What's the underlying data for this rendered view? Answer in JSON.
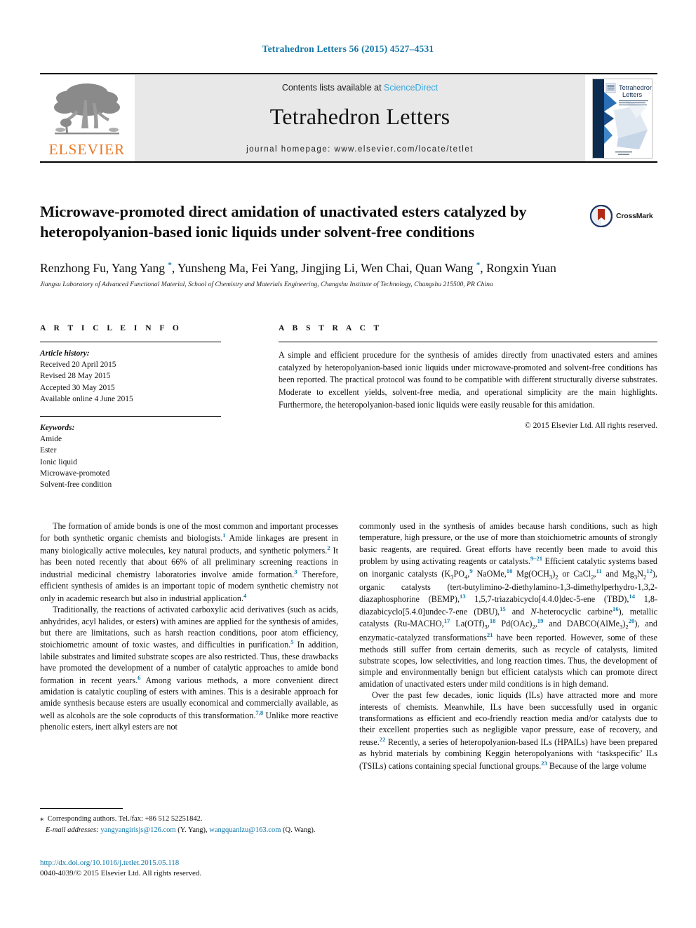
{
  "running_head": "Tetrahedron Letters 56 (2015) 4527–4531",
  "masthead": {
    "contents_prefix": "Contents lists available at ",
    "sciencedirect": "ScienceDirect",
    "journal_name": "Tetrahedron Letters",
    "homepage": "journal homepage: www.elsevier.com/locate/tetlet",
    "publisher_logo_text": "ELSEVIER",
    "cover_title_line1": "Tetrahedron",
    "cover_title_line2": "Letters",
    "colors": {
      "accent_blue": "#1277a8",
      "sciencedirect_blue": "#3aa6dd",
      "elsevier_orange": "#e87722",
      "masthead_grey": "#e8e8e8"
    }
  },
  "title": "Microwave-promoted direct amidation of unactivated esters catalyzed by heteropolyanion-based ionic liquids under solvent-free conditions",
  "crossmark": {
    "label": "CrossMark"
  },
  "authors_html": "Renzhong Fu, Yang Yang <sup>*</sup>, Yunsheng Ma, Fei Yang, Jingjing Li, Wen Chai, Quan Wang <sup>*</sup>, Rongxin Yuan",
  "affiliation": "Jiangsu Laboratory of Advanced Functional Material, School of Chemistry and Materials Engineering, Changshu Institute of Technology, Changshu 215500, PR China",
  "article_info": {
    "heading": "A R T I C L E   I N F O",
    "history_label": "Article history:",
    "history": [
      "Received 20 April 2015",
      "Revised 28 May 2015",
      "Accepted 30 May 2015",
      "Available online 4 June 2015"
    ],
    "keywords_label": "Keywords:",
    "keywords": [
      "Amide",
      "Ester",
      "Ionic liquid",
      "Microwave-promoted",
      "Solvent-free condition"
    ]
  },
  "abstract": {
    "heading": "A B S T R A C T",
    "text": "A simple and efficient procedure for the synthesis of amides directly from unactivated esters and amines catalyzed by heteropolyanion-based ionic liquids under microwave-promoted and solvent-free conditions has been reported. The practical protocol was found to be compatible with different structurally diverse substrates. Moderate to excellent yields, solvent-free media, and operational simplicity are the main highlights. Furthermore, the heteropolyanion-based ionic liquids were easily reusable for this amidation.",
    "copyright": "© 2015 Elsevier Ltd. All rights reserved."
  },
  "body": {
    "left_paragraphs_html": [
      "The formation of amide bonds is one of the most common and important processes for both synthetic organic chemists and biologists.<sup>1</sup> Amide linkages are present in many biologically active molecules, key natural products, and synthetic polymers.<sup>2</sup> It has been noted recently that about 66% of all preliminary screening reactions in industrial medicinal chemistry laboratories involve amide formation.<sup>3</sup> Therefore, efficient synthesis of amides is an important topic of modern synthetic chemistry not only in academic research but also in industrial application.<sup>4</sup>",
      "Traditionally, the reactions of activated carboxylic acid derivatives (such as acids, anhydrides, acyl halides, or esters) with amines are applied for the synthesis of amides, but there are limitations, such as harsh reaction conditions, poor atom efficiency, stoichiometric amount of toxic wastes, and difficulties in purification.<sup>5</sup> In addition, labile substrates and limited substrate scopes are also restricted. Thus, these drawbacks have promoted the development of a number of catalytic approaches to amide bond formation in recent years.<sup>6</sup> Among various methods, a more convenient direct amidation is catalytic coupling of esters with amines. This is a desirable approach for amide synthesis because esters are usually economical and commercially available, as well as alcohols are the sole coproducts of this transformation.<sup>7,8</sup> Unlike more reactive phenolic esters, inert alkyl esters are not"
    ],
    "right_paragraphs_html": [
      "commonly used in the synthesis of amides because harsh conditions, such as high temperature, high pressure, or the use of more than stoichiometric amounts of strongly basic reagents, are required. Great efforts have recently been made to avoid this problem by using activating reagents or catalysts.<sup>9–21</sup> Efficient catalytic systems based on inorganic catalysts (K<sub>3</sub>PO<sub>4</sub>,<sup>9</sup> NaOMe,<sup>10</sup> Mg(OCH<sub>3</sub>)<sub>2</sub> or CaCl<sub>2</sub>,<sup>11</sup> and Mg<sub>3</sub>N<sub>2</sub><sup>12</sup>), organic catalysts (tert-butylimino-2-diethylamino-1,3-dimethylperhydro-1,3,2-diazaphosphorine (BEMP),<sup>13</sup> 1,5,7-triazabicyclo[4.4.0]dec-5-ene (TBD),<sup>14</sup> 1,8-diazabicyclo[5.4.0]undec-7-ene (DBU),<sup>15</sup> and <span class=\"ital\">N</span>-heterocyclic carbine<sup>16</sup>), metallic catalysts (Ru-MACHO,<sup>17</sup> La(OTf)<sub>3</sub>,<sup>18</sup> Pd(OAc)<sub>2</sub>,<sup>19</sup> and DABCO(AlMe<sub>3</sub>)<sub>2</sub><sup>20</sup>), and enzymatic-catalyzed transformations<sup>21</sup> have been reported. However, some of these methods still suffer from certain demerits, such as recycle of catalysts, limited substrate scopes, low selectivities, and long reaction times. Thus, the development of simple and environmentally benign but efficient catalysts which can promote direct amidation of unactivated esters under mild conditions is in high demand.",
      "Over the past few decades, ionic liquids (ILs) have attracted more and more interests of chemists. Meanwhile, ILs have been successfully used in organic transformations as efficient and eco-friendly reaction media and/or catalysts due to their excellent properties such as negligible vapor pressure, ease of recovery, and reuse.<sup>22</sup> Recently, a series of heteropolyanion-based ILs (HPAILs) have been prepared as hybrid materials by combining Keggin heteropolyanions with ‘taskspecific’ ILs (TSILs) cations containing special functional groups.<sup>23</sup> Because of the large volume"
    ]
  },
  "footnotes": {
    "corresponding_html": "<span class=\"star\">⁎</span>&nbsp; Corresponding authors. Tel./fax: +86 512 52251842.",
    "email_label": "E-mail addresses:",
    "email_1": "yangyangirisjs@126.com",
    "email_1_owner": "(Y. Yang)",
    "email_2": "wangquanlzu@163.com",
    "email_2_owner": "(Q. Wang).",
    "doi": "http://dx.doi.org/10.1016/j.tetlet.2015.05.118",
    "issn_line": "0040-4039/© 2015 Elsevier Ltd. All rights reserved."
  }
}
